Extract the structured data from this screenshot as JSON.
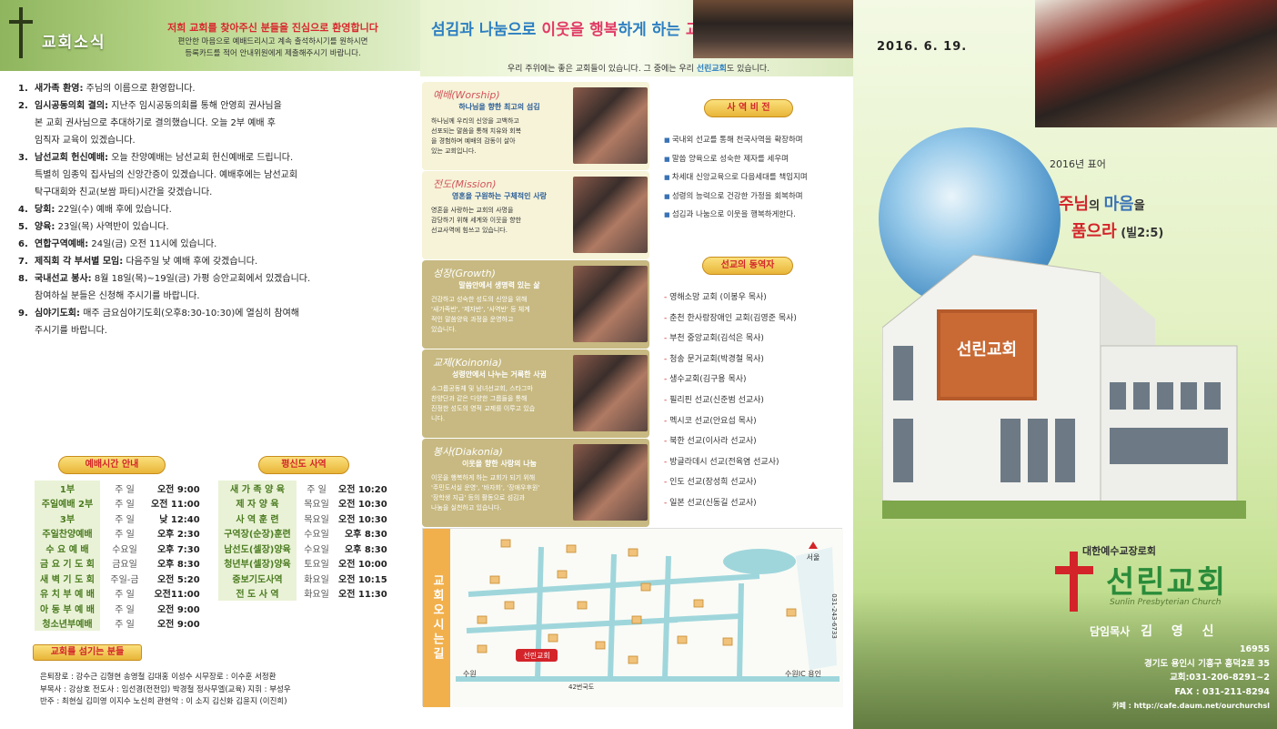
{
  "panel1": {
    "title": "교회소식",
    "banner_red": "저희 교회를 찾아주신 분들을 진심으로 환영합니다",
    "banner_sub": [
      "편안한 마음으로 예배드리시고 계속 출석하시기를 원하시면",
      "등록카드를 적어 안내위원에게 제출해주시기 바랍니다."
    ],
    "notices": [
      {
        "n": "1.",
        "head": "새가족 환영:",
        "lines": [
          "주님의 이름으로 환영합니다."
        ]
      },
      {
        "n": "2.",
        "head": "임시공동의회 결의:",
        "lines": [
          "지난주 임시공동의회를 통해 안영희 권사님을",
          "본 교회 권사님으로 추대하기로 결의했습니다. 오늘 2부 예배 후",
          "임직자 교육이 있겠습니다."
        ]
      },
      {
        "n": "3.",
        "head": "남선교회 헌신예배:",
        "lines": [
          "오늘 찬양예배는 남선교회 헌신예배로 드립니다.",
          "특별히 임종익 집사님의 신앙간증이 있겠습니다. 예배후에는 남선교회",
          "탁구대회와 친교(보쌈 파티)시간을 갖겠습니다."
        ]
      },
      {
        "n": "4.",
        "head": "당회:",
        "lines": [
          "22일(수) 예배 후에 있습니다."
        ]
      },
      {
        "n": "5.",
        "head": "양육:",
        "lines": [
          "23일(목) 사역반이 있습니다."
        ]
      },
      {
        "n": "6.",
        "head": "연합구역예배:",
        "lines": [
          "24일(금) 오전 11시에 있습니다."
        ]
      },
      {
        "n": "7.",
        "head": "제직회 각 부서별 모임:",
        "lines": [
          "다음주일 낮 예배 후에 갖겠습니다."
        ]
      },
      {
        "n": "8.",
        "head": "국내선교 봉사:",
        "lines": [
          "8월 18일(목)~19일(금) 가평 승안교회에서 있겠습니다.",
          "참여하실 분들은 신청해 주시기를 바랍니다."
        ]
      },
      {
        "n": "9.",
        "head": "심야기도회:",
        "lines": [
          "매주 금요심야기도회(오후8:30-10:30)에 열심히 참여해",
          "주시기를 바랍니다."
        ]
      }
    ],
    "worship_header": "예배시간 안내",
    "worship": [
      {
        "name": "1부",
        "day": "주 일",
        "time": "오전 9:00"
      },
      {
        "name": "주일예배 2부",
        "day": "주 일",
        "time": "오전 11:00"
      },
      {
        "name": "3부",
        "day": "주 일",
        "time": "낮 12:40"
      },
      {
        "name": "주일찬양예배",
        "day": "주 일",
        "time": "오후 2:30"
      },
      {
        "name": "수 요 예 배",
        "day": "수요일",
        "time": "오후 7:30"
      },
      {
        "name": "금 요 기 도 회",
        "day": "금요일",
        "time": "오후 8:30"
      },
      {
        "name": "새 벽 기 도 회",
        "day": "주일-금",
        "time": "오전 5:20"
      },
      {
        "name": "유 치 부 예 배",
        "day": "주 일",
        "time": "오전11:00"
      },
      {
        "name": "아 동 부 예 배",
        "day": "주 일",
        "time": "오전 9:00"
      },
      {
        "name": "청소년부예배",
        "day": "주 일",
        "time": "오전 9:00"
      }
    ],
    "training_header": "평신도 사역",
    "training": [
      {
        "name": "새 가 족 양 육",
        "day": "주 일",
        "time": "오전 10:20"
      },
      {
        "name": "제 자 양 육",
        "day": "목요일",
        "time": "오전 10:30"
      },
      {
        "name": "사 역 훈 련",
        "day": "목요일",
        "time": "오전 10:30"
      },
      {
        "name": "구역장(순장)훈련",
        "day": "수요일",
        "time": "오후 8:30"
      },
      {
        "name": "남선도(셀장)양육",
        "day": "수요일",
        "time": "오후 8:30"
      },
      {
        "name": "청년부(셀장)양육",
        "day": "토요일",
        "time": "오전 10:00"
      },
      {
        "name": "중보기도사역",
        "day": "화요일",
        "time": "오전 10:15"
      },
      {
        "name": "전 도 사 역",
        "day": "화요일",
        "time": "오전 11:30"
      }
    ],
    "serve_header": "교회를 섬기는 분들",
    "serve_lines": [
      "은퇴장로 : 강수근 김형현 송영철 김대홍 이성수 시무장로 : 이수훈 서정환",
      "부목사 : 강상호   전도사 : 임선경(전전임) 박경철 정사무엘(교육)  지휘 : 부성우",
      "반주 : 최현실 김미영 이지수 노신희   관현악 : 이 소지 김신화 김윤지 (이진희)"
    ]
  },
  "panel2": {
    "title_prefix": "섬김과 나눔으로 ",
    "title_r1": "이웃을 행복",
    "title_mid": "하게 하는 ",
    "title_r2": "교회",
    "subtitle_a": "우리 주위에는 좋은 교회들이 있습니다. 그 중에는 우리 ",
    "subtitle_b": "선린교회",
    "subtitle_c": "도 있습니다.",
    "ministries": [
      {
        "title": "예배(Worship)",
        "sub": "하나님을 향한 최고의 섬김",
        "desc": [
          "하나님께 우리의 신앙을 고백하고",
          "선포되는 말씀을 통해 치유와 회복",
          "을 경험하며 예배의 감동이 살아",
          "있는 교회입니다."
        ]
      },
      {
        "title": "전도(Mission)",
        "sub": "영혼을 구원하는 구체적인 사랑",
        "desc": [
          "영혼을 사랑하는 교회의 사명을",
          "감당하기 위해 세계와 이웃을 향한",
          "선교사역에 힘쓰고 있습니다."
        ]
      },
      {
        "title": "성장(Growth)",
        "sub": "말씀안에서 생명력 있는 삶",
        "desc": [
          "건강하고 성숙한 성도의 신앙을 위해",
          "'새가족반', '제자반', '사역반' 등 체계",
          "적인 말씀양육 과정을 운영하고",
          "있습니다."
        ]
      },
      {
        "title": "교제(Koinonia)",
        "sub": "성령안에서 나누는 거룩한 사귐",
        "desc": [
          "소그룹공동체 및 남녀선교회, 스타그마",
          "찬양단과 같은 다양한 그룹들을 통해",
          "진정한 성도의 영적 교제를 이루고 있습",
          "니다."
        ]
      },
      {
        "title": "봉사(Diakonia)",
        "sub": "이웃을 향한 사랑의 나눔",
        "desc": [
          "이웃을 행복하게 하는 교회가 되기 위해",
          "'주민도서실 운영', '바자회', '장애우후원'",
          "'장학생 지급' 등의 활동으로 섬김과",
          "나눔을 실천하고 있습니다."
        ]
      }
    ],
    "vision_header": "사 역 비 전",
    "vision": [
      "국내외 선교를 통해 천국사역을 확장하며",
      "말씀 양육으로 성숙한 제자를 세우며",
      "차세대 신앙교육으로 다음세대를 책임지며",
      "성령의 능력으로 건강한 가정을 회복하며",
      "섬김과 나눔으로 이웃을 행복하게한다."
    ],
    "missions_header": "선교의 동역자",
    "missions": [
      "영해소망 교회 (이봉우 목사)",
      "춘천 한사랑장애인 교회(김영준 목사)",
      "부천 중앙교회(김석은 목사)",
      "청송 문거교회(박경철 목사)",
      "생수교회(김구용 목사)",
      "필리핀 선교(신준범 선교사)",
      "멕시코 선교(안요섭 목사)",
      "북한 선교(이사라 선교사)",
      "방글라데시 선교(전육염 선교사)",
      "인도 선교(장성희 선교사)",
      "일본 선교(신동길 선교사)"
    ],
    "map_label": "교회오시는길",
    "map": {
      "church": "선린교회",
      "suwon": "수원",
      "seoul": "서울",
      "ic": "수원IC 용인",
      "road": "42번국도",
      "phone": "031-243-6733"
    }
  },
  "panel3": {
    "date": "2016. 6. 19.",
    "motto_year": "2016년 표어",
    "motto_1a": "주님",
    "motto_1b": "의 ",
    "motto_1c": "마음",
    "motto_1d": "을",
    "motto_2a": "품으라",
    "motto_2b": " (빌2:5)",
    "denomination": "대한예수교장로회",
    "church_name": "선린교회",
    "church_eng": "Sunlin Presbyterian Church",
    "pastor_label": "담임목사",
    "pastor_name": "김 영 신",
    "zip": "16955",
    "address": "경기도 용인시 기흥구 흥덕2로 35",
    "phone": "교회:031-206-8291~2",
    "fax": "FAX : 031-211-8294",
    "cafe": "카페 : http://cafe.daum.net/ourchurchsl",
    "sign_text": "선린교회"
  },
  "colors": {
    "green": "#2a8c3a",
    "red": "#d3242a",
    "blue": "#2c7fc1",
    "gold": "#e8b538"
  }
}
